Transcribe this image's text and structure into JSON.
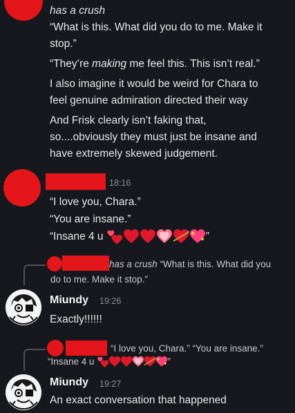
{
  "message_1": {
    "lines": [
      {
        "italic": "has a crush"
      },
      {
        "text": "“What is this. What did you do to me. Make it"
      },
      {
        "text": "stop.”"
      },
      {
        "pre": "“They’re ",
        "italic": "making",
        "post": " me feel this. This isn’t real.”"
      },
      {
        "text": "I also imagine it would be weird for Chara to"
      },
      {
        "text": "feel genuine admiration directed their way"
      },
      {
        "text": "And Frisk clearly isn’t faking that,"
      },
      {
        "text": "so....obviously they must just be insane and"
      },
      {
        "text": "have extremely skewed judgement."
      }
    ]
  },
  "message_2": {
    "timestamp": "18:16",
    "line1": "“I love you, Chara.”",
    "line2": "“You are insane.”",
    "line3_prefix": "“Insane 4 u",
    "line3_suffix": "”"
  },
  "reply_1": {
    "italic": "has a crush",
    "quote_line1": "“What is this. What did you",
    "quote_line2": "do to me. Make it stop.”"
  },
  "message_3": {
    "author": "Miundy",
    "timestamp": "19:26",
    "text": "Exactly!!!!!!"
  },
  "reply_2": {
    "quote_line1": "“I love you, Chara.” “You are insane.”",
    "quote_line2_prefix": "“Insane 4 u",
    "quote_line2_suffix": "”"
  },
  "message_4": {
    "author": "Miundy",
    "timestamp": "19:27",
    "text": "An exact conversation that happened"
  },
  "emoji": [
    "two-hearts-icon",
    "heart-icon",
    "heart-icon",
    "heart-glow-icon",
    "heart-arrow-icon",
    "sparkle-heart-icon"
  ],
  "colors": {
    "background": "#17181d",
    "redaction": "#e5161b",
    "heart": "#e0182c"
  }
}
